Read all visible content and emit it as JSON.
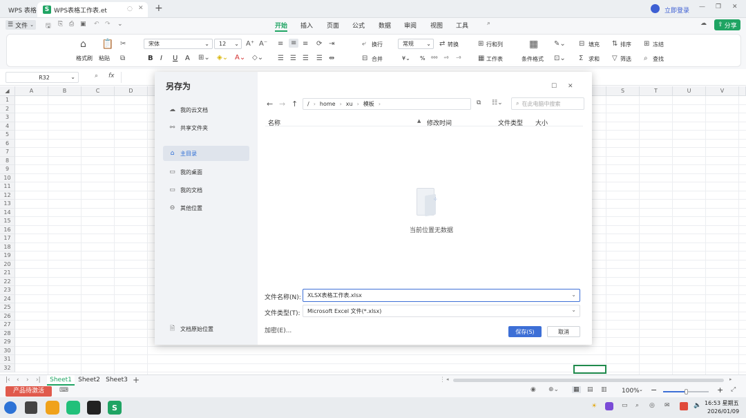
{
  "titlebar": {
    "app_tab": "WPS 表格",
    "doc_tab": "WPS表格工作表.et",
    "login": "立即登录"
  },
  "menubar": {
    "file": "文件",
    "tabs": [
      "开始",
      "插入",
      "页面",
      "公式",
      "数据",
      "审阅",
      "视图",
      "工具"
    ],
    "share": "分享"
  },
  "ribbon": {
    "format_painter": "格式刷",
    "paste": "粘贴",
    "font_name": "宋体",
    "font_size": "12",
    "wrap": "换行",
    "merge": "合并",
    "number_format": "常规",
    "convert": "转换",
    "row_col": "行和列",
    "worksheet": "工作表",
    "cond_format": "条件格式",
    "fill": "填充",
    "sort": "排序",
    "freeze": "冻结",
    "sum": "求和",
    "filter": "筛选",
    "find": "查找"
  },
  "formulabar": {
    "cell_ref": "R32",
    "fx": "fx"
  },
  "grid": {
    "columns_left": [
      "A",
      "B",
      "C",
      "D"
    ],
    "columns_right": [
      "S",
      "T",
      "U",
      "V"
    ],
    "rows": [
      "1",
      "2",
      "3",
      "4",
      "5",
      "6",
      "7",
      "8",
      "9",
      "10",
      "11",
      "12",
      "13",
      "14",
      "15",
      "16",
      "17",
      "18",
      "19",
      "20",
      "21",
      "22",
      "23",
      "24",
      "25",
      "26",
      "27",
      "28",
      "29",
      "30",
      "31",
      "32"
    ]
  },
  "sheets": {
    "tabs": [
      "Sheet1",
      "Sheet2",
      "Sheet3"
    ],
    "active": "Sheet1"
  },
  "statusbar": {
    "promo": "产品待激活",
    "zoom": "100%"
  },
  "taskbar": {
    "time": "16:53 星期五",
    "date": "2026/01/09"
  },
  "dialog": {
    "title": "另存为",
    "sidebar": [
      "我的云文档",
      "共享文件夹",
      "主目录",
      "我的桌面",
      "我的文档",
      "其他位置"
    ],
    "sidebar_bottom": "文档原始位置",
    "path": [
      "/",
      "home",
      "xu",
      "模板"
    ],
    "search_placeholder": "在此电脑中搜索",
    "columns": {
      "name": "名称",
      "modified": "修改时间",
      "type": "文件类型",
      "size": "大小"
    },
    "empty_text": "当前位置无数据",
    "filename_label": "文件名称(N):",
    "filename_value": "XLSX表格工作表.xlsx",
    "filetype_label": "文件类型(T):",
    "filetype_value": "Microsoft Excel 文件(*.xlsx)",
    "encrypt": "加密(E)...",
    "save": "保存(S)",
    "cancel": "取消"
  }
}
